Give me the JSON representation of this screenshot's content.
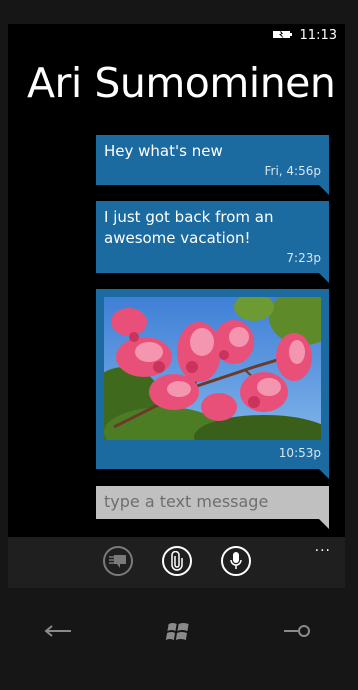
{
  "status": {
    "time": "11:13",
    "battery_icon": "battery-icon"
  },
  "contact": {
    "name": "Ari Sumominen"
  },
  "messages": [
    {
      "text": "Hey what's new",
      "timestamp": "Fri, 4:56p"
    },
    {
      "text": "I just got back from an awesome vacation!",
      "timestamp": "7:23p"
    },
    {
      "text": "",
      "timestamp": "10:53p",
      "attachment": "flower-photo"
    }
  ],
  "compose": {
    "placeholder": "type a text message"
  },
  "appbar": {
    "buttons": [
      "switch-thread-icon",
      "attach-icon",
      "microphone-icon"
    ],
    "more": "..."
  },
  "navbar": [
    "back-icon",
    "windows-start-icon",
    "search-icon"
  ],
  "colors": {
    "bubble": "#1b6aa0",
    "compose": "#c0c0c0",
    "appbar": "#1f1f1f"
  }
}
